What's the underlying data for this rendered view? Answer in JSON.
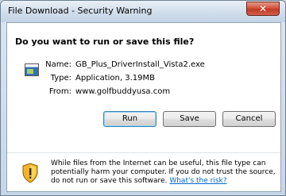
{
  "window": {
    "title": "File Download - Security Warning",
    "close_symbol": "✕"
  },
  "dialog": {
    "question": "Do you want to run or save this file?",
    "file": {
      "icon": "application-file-icon",
      "name_label": "Name:",
      "name_value": "GB_Plus_DriverInstall_Vista2.exe",
      "type_label": "Type:",
      "type_value": "Application, 3.19MB",
      "from_label": "From:",
      "from_value": "www.golfbuddyusa.com"
    },
    "buttons": {
      "run": "Run",
      "save": "Save",
      "cancel": "Cancel"
    },
    "warning": {
      "icon": "shield-warning-icon",
      "text": "While files from the Internet can be useful, this file type can potentially harm your computer. If you do not trust the source, do not run or save this software.",
      "link": "What's the risk?"
    }
  }
}
